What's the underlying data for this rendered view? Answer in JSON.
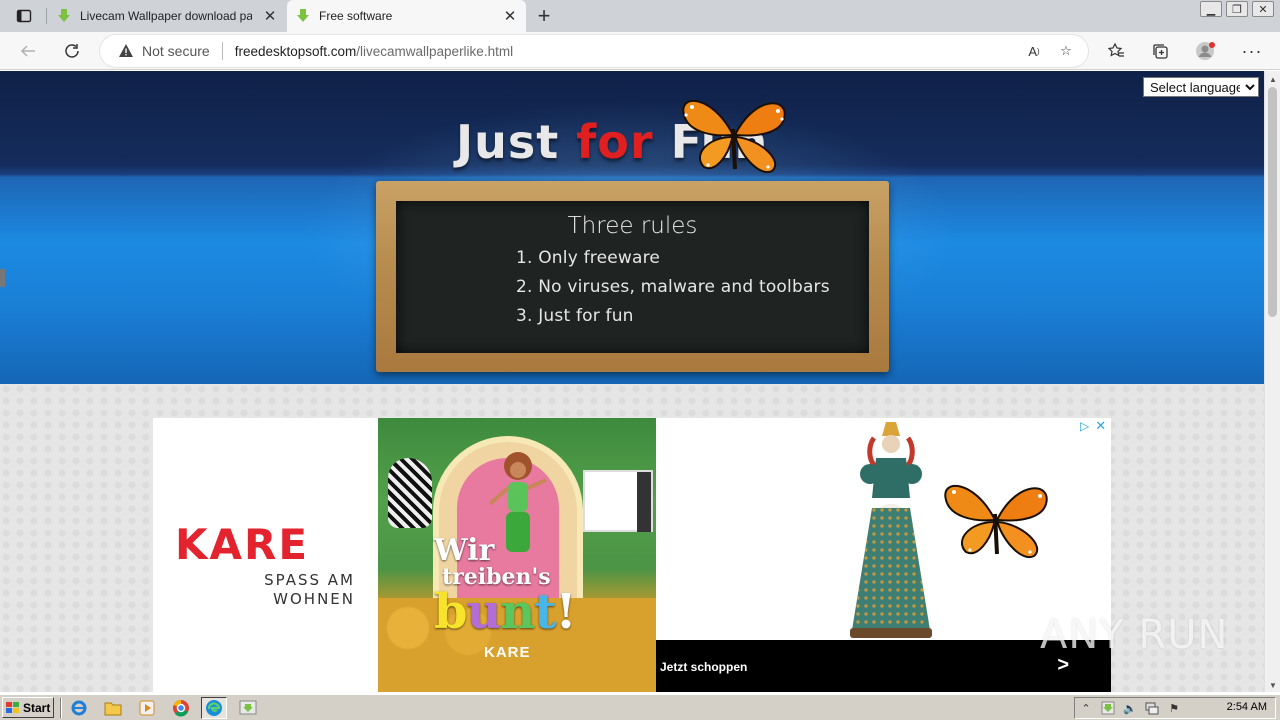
{
  "browser": {
    "tabs": [
      {
        "title": "Livecam Wallpaper download pa",
        "active": false
      },
      {
        "title": "Free software",
        "active": true
      }
    ],
    "address": {
      "security_label": "Not secure",
      "domain": "freedesktopsoft.com",
      "path": "/livecamwallpaperlike.html"
    }
  },
  "page": {
    "logo": {
      "part1": "Just ",
      "part2": "for",
      "part3": " Fun"
    },
    "language_select": {
      "selected": "Select language"
    },
    "board": {
      "title": "Three rules",
      "rules": [
        "1. Only freeware",
        "2. No viruses, malware and toolbars",
        "3. Just for fun"
      ]
    },
    "ad": {
      "brand": "KARE",
      "brand_tagline_line1": "SPASS AM",
      "brand_tagline_line2": "WOHNEN",
      "slogan_line1": "Wir",
      "slogan_line2": "treiben's",
      "slogan_letters": [
        "b",
        "u",
        "n",
        "t",
        "!"
      ],
      "photo_brand": "KARE",
      "cta": "Jetzt schoppen"
    },
    "watermark": "ANY RUN"
  },
  "taskbar": {
    "start_label": "Start",
    "clock": "2:54 AM"
  },
  "colors": {
    "logo_red": "#e02020",
    "kare_red": "#e3232e",
    "header_blue": "#1c8ae2"
  }
}
